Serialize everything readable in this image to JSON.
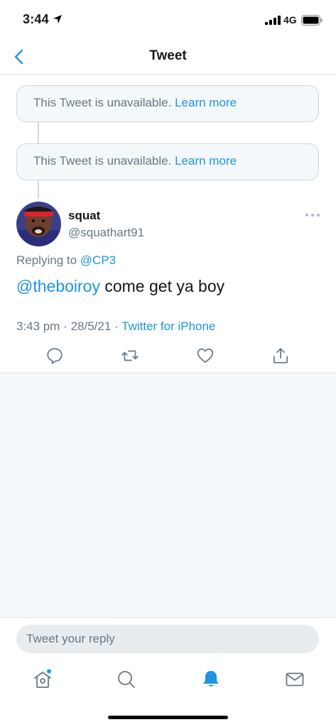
{
  "status_bar": {
    "time": "3:44",
    "network": "4G",
    "icons": [
      "location-arrow-icon",
      "cellular-signal-icon",
      "battery-icon"
    ]
  },
  "nav": {
    "title": "Tweet",
    "back_icon": "chevron-left-icon"
  },
  "unavailable_tweets": [
    {
      "text": "This Tweet is unavailable.",
      "link": "Learn more"
    },
    {
      "text": "This Tweet is unavailable.",
      "link": "Learn more"
    }
  ],
  "tweet": {
    "display_name": "squat",
    "username": "@squathart91",
    "replying_prefix": "Replying to",
    "replying_to": "@CP3",
    "mention": "@theboiroy",
    "body": "come get ya boy",
    "time": "3:43 pm",
    "date": "28/5/21",
    "source": "Twitter for iPhone",
    "actions": [
      "reply-icon",
      "retweet-icon",
      "like-icon",
      "share-icon"
    ]
  },
  "reply": {
    "placeholder": "Tweet your reply"
  },
  "tab_bar": {
    "items": [
      "home-icon",
      "search-icon",
      "notifications-icon",
      "messages-icon"
    ],
    "active": "notifications-icon"
  },
  "colors": {
    "accent": "#1b95e0",
    "secondary_text": "#657786",
    "background": "#f5f8fa"
  }
}
